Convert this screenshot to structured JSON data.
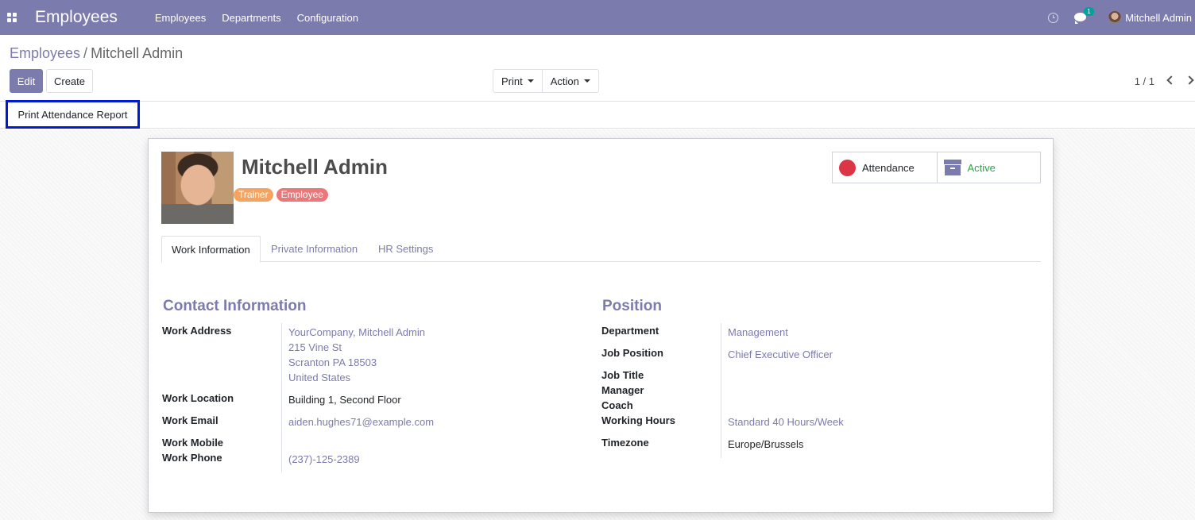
{
  "navbar": {
    "app_title": "Employees",
    "menu": [
      "Employees",
      "Departments",
      "Configuration"
    ],
    "chat_badge": "1",
    "user_name": "Mitchell Admin"
  },
  "breadcrumb": {
    "parent": "Employees",
    "separator": "/",
    "current": "Mitchell Admin"
  },
  "toolbar": {
    "edit_label": "Edit",
    "create_label": "Create",
    "print_label": "Print",
    "action_label": "Action",
    "pager": "1 / 1"
  },
  "statusbar": {
    "attendance_report_label": "Print Attendance Report"
  },
  "employee": {
    "name": "Mitchell Admin",
    "tags": [
      "Trainer",
      "Employee"
    ],
    "smart_buttons": {
      "attendance": "Attendance",
      "active": "Active"
    }
  },
  "tabs": [
    "Work Information",
    "Private Information",
    "HR Settings"
  ],
  "contact": {
    "title": "Contact Information",
    "work_address_label": "Work Address",
    "work_address": [
      "YourCompany, Mitchell Admin",
      "215 Vine St",
      "Scranton PA 18503",
      "United States"
    ],
    "work_location_label": "Work Location",
    "work_location": "Building 1, Second Floor",
    "work_email_label": "Work Email",
    "work_email": "aiden.hughes71@example.com",
    "work_mobile_label": "Work Mobile",
    "work_phone_label": "Work Phone",
    "work_phone": "(237)-125-2389"
  },
  "position": {
    "title": "Position",
    "department_label": "Department",
    "department": "Management",
    "job_position_label": "Job Position",
    "job_position": "Chief Executive Officer",
    "job_title_label": "Job Title",
    "manager_label": "Manager",
    "coach_label": "Coach",
    "working_hours_label": "Working Hours",
    "working_hours": "Standard 40 Hours/Week",
    "timezone_label": "Timezone",
    "timezone": "Europe/Brussels"
  },
  "colors": {
    "brand": "#7c7bad",
    "attendance_dot": "#dc3545",
    "active": "#28a745",
    "highlight_border": "#0018d8"
  }
}
